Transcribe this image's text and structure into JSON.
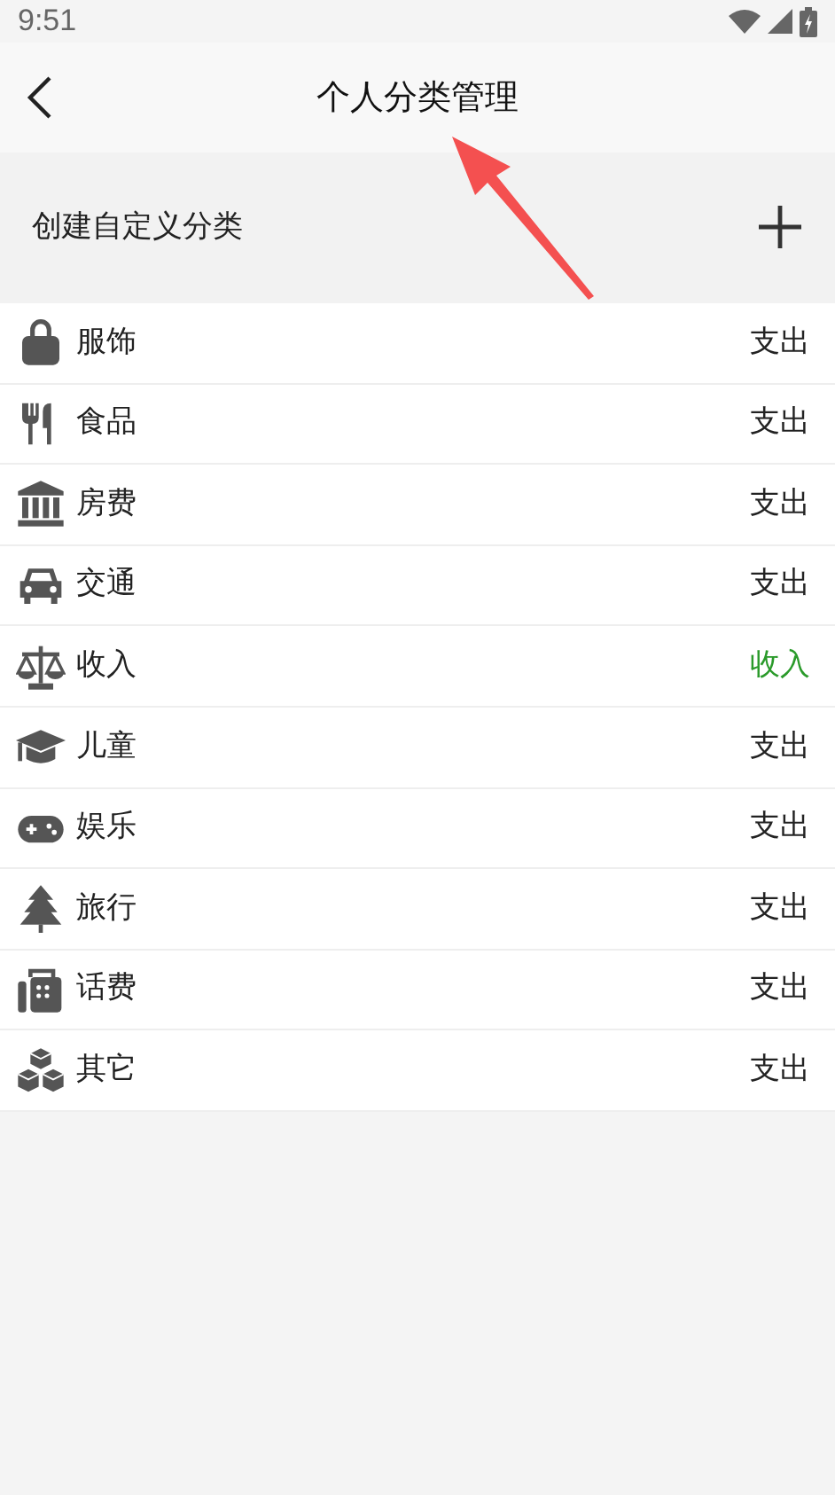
{
  "status_bar": {
    "time": "9:51"
  },
  "header": {
    "title": "个人分类管理"
  },
  "create_row": {
    "label": "创建自定义分类"
  },
  "categories": [
    {
      "name": "服饰",
      "type": "支出",
      "kind": "expense"
    },
    {
      "name": "食品",
      "type": "支出",
      "kind": "expense"
    },
    {
      "name": "房费",
      "type": "支出",
      "kind": "expense"
    },
    {
      "name": "交通",
      "type": "支出",
      "kind": "expense"
    },
    {
      "name": "收入",
      "type": "收入",
      "kind": "income"
    },
    {
      "name": "儿童",
      "type": "支出",
      "kind": "expense"
    },
    {
      "name": "娱乐",
      "type": "支出",
      "kind": "expense"
    },
    {
      "name": "旅行",
      "type": "支出",
      "kind": "expense"
    },
    {
      "name": "话费",
      "type": "支出",
      "kind": "expense"
    },
    {
      "name": "其它",
      "type": "支出",
      "kind": "expense"
    }
  ]
}
